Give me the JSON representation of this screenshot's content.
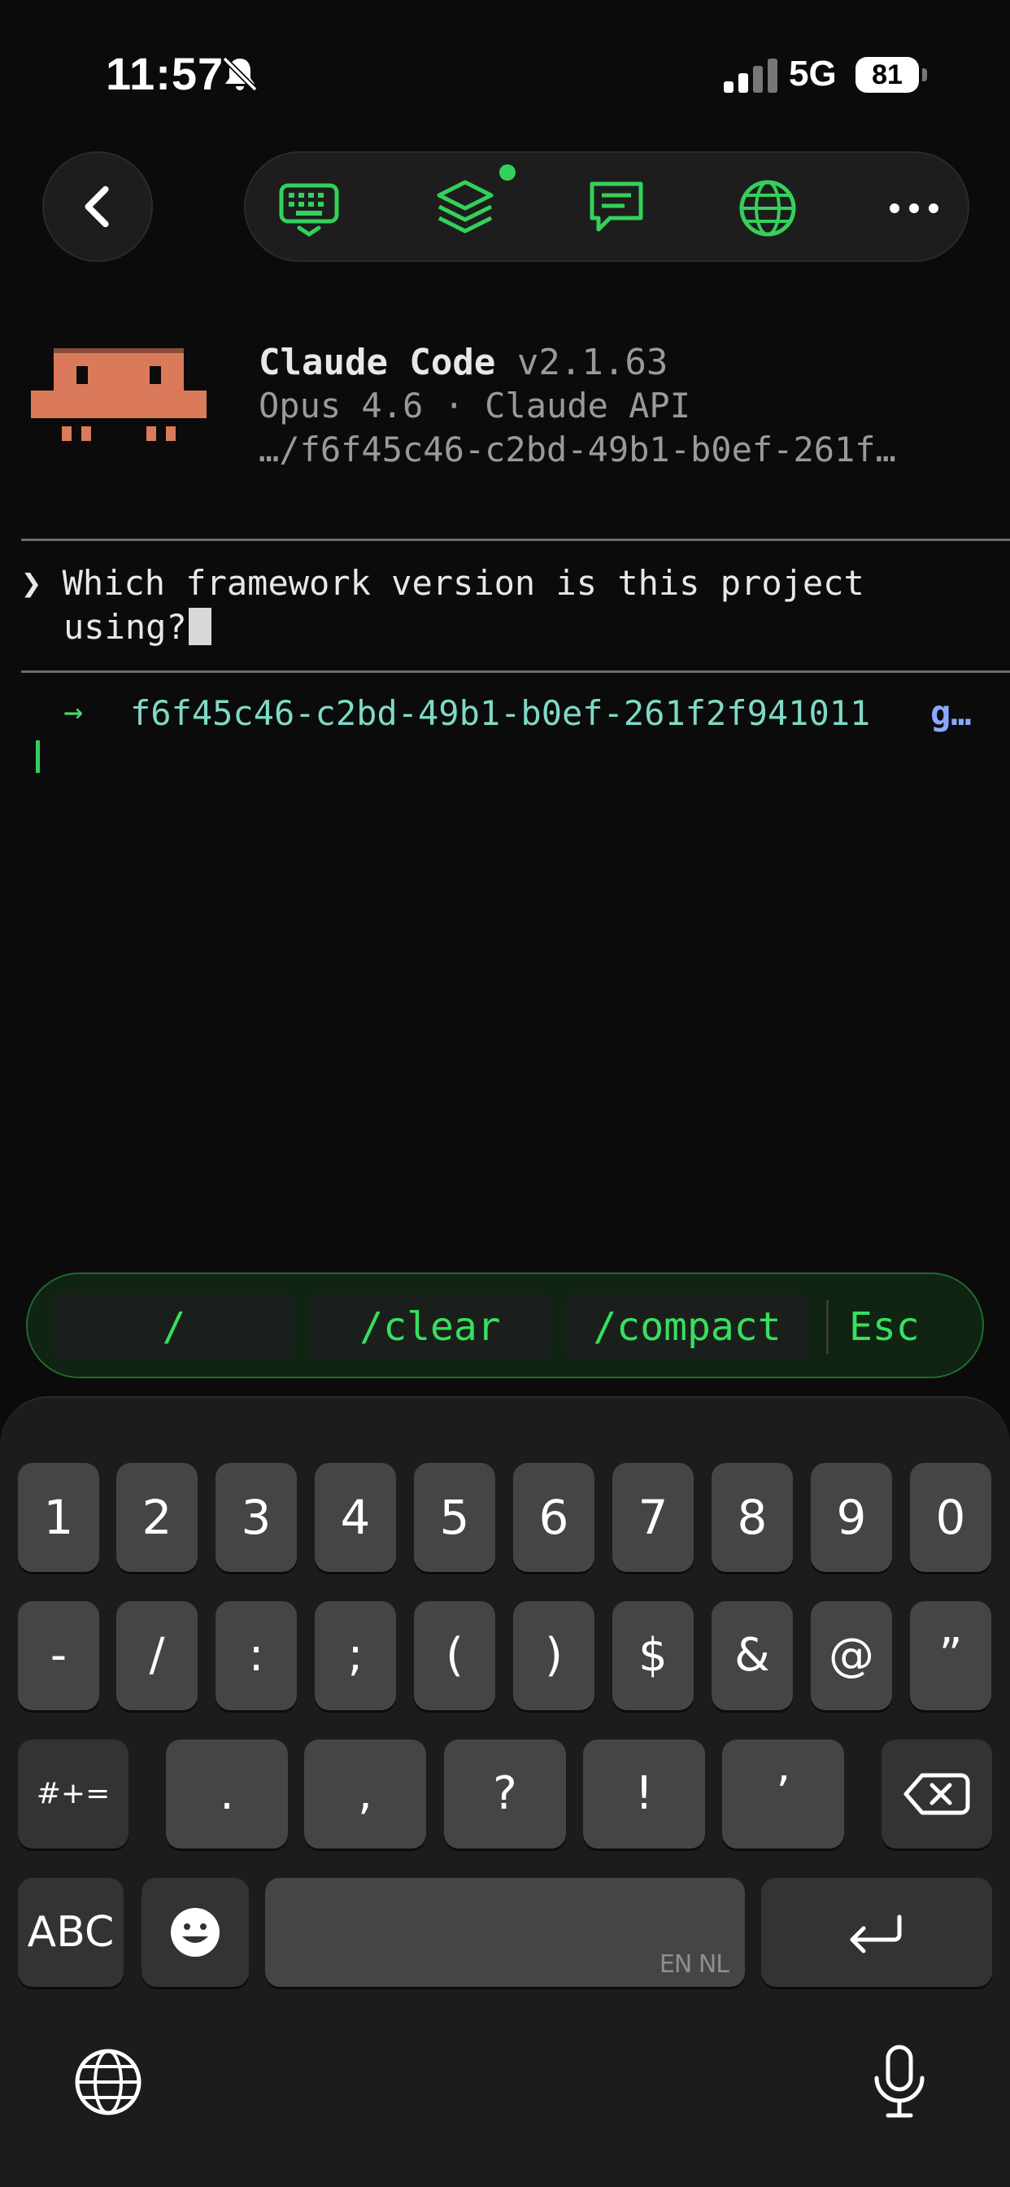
{
  "status_bar": {
    "time": "11:57",
    "network": "5G",
    "battery": "81",
    "icons": [
      "bell-slash-icon",
      "signal-icon"
    ]
  },
  "toolbar": {
    "icons": [
      "keyboard-icon",
      "layers-icon",
      "message-icon",
      "globe-icon",
      "more-icon"
    ],
    "accent": "#33d15a"
  },
  "header": {
    "app_name": "Claude Code",
    "version": "v2.1.63",
    "model_line": "Opus 4.6 · Claude API",
    "path_line": "…/f6f45c46-c2bd-49b1-b0ef-261f…"
  },
  "prompt": {
    "chevron": "❯",
    "line1": "Which framework version is this project",
    "line2": "using?"
  },
  "branch": {
    "arrow": "→",
    "id": "f6f45c46-c2bd-49b1-b0ef-261f2f941011",
    "git": "g…"
  },
  "shortcuts": [
    "/",
    "/clear",
    "/compact",
    "Esc"
  ],
  "keyboard": {
    "row1": [
      "1",
      "2",
      "3",
      "4",
      "5",
      "6",
      "7",
      "8",
      "9",
      "0"
    ],
    "row2": [
      "-",
      "/",
      ":",
      ";",
      "(",
      ")",
      "$",
      "&",
      "@",
      "”"
    ],
    "row3": [
      "#+=",
      ".",
      ",",
      "?",
      "!",
      "’"
    ],
    "abc": "ABC",
    "space_lang": "EN NL"
  }
}
